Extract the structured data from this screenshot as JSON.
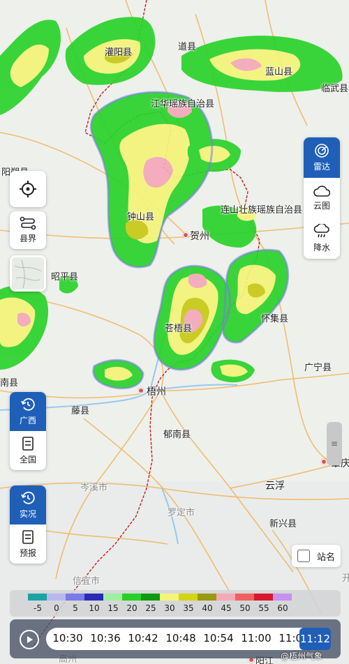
{
  "map": {
    "cities": [
      {
        "name": "灌阳县",
        "id": "guanyang"
      },
      {
        "name": "道县",
        "id": "daoxian"
      },
      {
        "name": "蓝山县",
        "id": "lanshan"
      },
      {
        "name": "临武县",
        "id": "linwu"
      },
      {
        "name": "江华瑶族自治县",
        "id": "jianghua"
      },
      {
        "name": "阳朔县",
        "id": "yangshuo"
      },
      {
        "name": "连山壮族瑶族自治县",
        "id": "lianshan"
      },
      {
        "name": "钟山县",
        "id": "zhongshan"
      },
      {
        "name": "贺州",
        "id": "hezhou"
      },
      {
        "name": "昭平县",
        "id": "zhaoping"
      },
      {
        "name": "苍梧县",
        "id": "cangwu"
      },
      {
        "name": "怀集县",
        "id": "huaiji"
      },
      {
        "name": "广宁县",
        "id": "guangning"
      },
      {
        "name": "南县",
        "id": "nanxian"
      },
      {
        "name": "梧州",
        "id": "wuzhou"
      },
      {
        "name": "藤县",
        "id": "tengxian"
      },
      {
        "name": "郁南县",
        "id": "yunan"
      },
      {
        "name": "肇庆",
        "id": "zhaoqing"
      },
      {
        "name": "岑溪市",
        "id": "cenxi"
      },
      {
        "name": "云浮",
        "id": "yunfu"
      },
      {
        "name": "罗定市",
        "id": "luoding"
      },
      {
        "name": "新兴县",
        "id": "xinxing"
      },
      {
        "name": "信宜市",
        "id": "xinyi"
      },
      {
        "name": "阳江",
        "id": "yangjiang"
      },
      {
        "name": "高州",
        "id": "gaozhou"
      },
      {
        "name": "开",
        "id": "kai"
      }
    ]
  },
  "controls": {
    "locate_label": "",
    "county_border_label": "县界",
    "region_tabs": [
      {
        "label": "广西",
        "active": true,
        "icon": "refresh-clock-icon"
      },
      {
        "label": "全国",
        "active": false,
        "icon": "document-icon"
      }
    ],
    "mode_tabs": [
      {
        "label": "实况",
        "active": true,
        "icon": "refresh-clock-icon"
      },
      {
        "label": "预报",
        "active": false,
        "icon": "document-icon"
      }
    ],
    "layer_tabs": [
      {
        "label": "雷达",
        "active": true,
        "icon": "radar-icon"
      },
      {
        "label": "云图",
        "active": false,
        "icon": "cloud-icon"
      },
      {
        "label": "降水",
        "active": false,
        "icon": "rain-icon"
      }
    ],
    "station_label": "站名",
    "station_checked": false
  },
  "legend": {
    "labels": [
      "-5",
      "0",
      "5",
      "10",
      "15",
      "20",
      "25",
      "30",
      "35",
      "40",
      "45",
      "50",
      "55",
      "60"
    ],
    "colors": [
      "#1aa5a5",
      "#b8b8f0",
      "#7a7ae8",
      "#2a2ab8",
      "#9ef09e",
      "#28d028",
      "#109a10",
      "#f4f47a",
      "#d4d414",
      "#9a9a10",
      "#f4a8b8",
      "#f06060",
      "#d81830",
      "#c890f0"
    ]
  },
  "timeline": {
    "times": [
      "10:30",
      "10:36",
      "10:42",
      "10:48",
      "10:54",
      "11:00",
      "11:06"
    ],
    "current": "11:12"
  },
  "watermark": "@梧州气象"
}
